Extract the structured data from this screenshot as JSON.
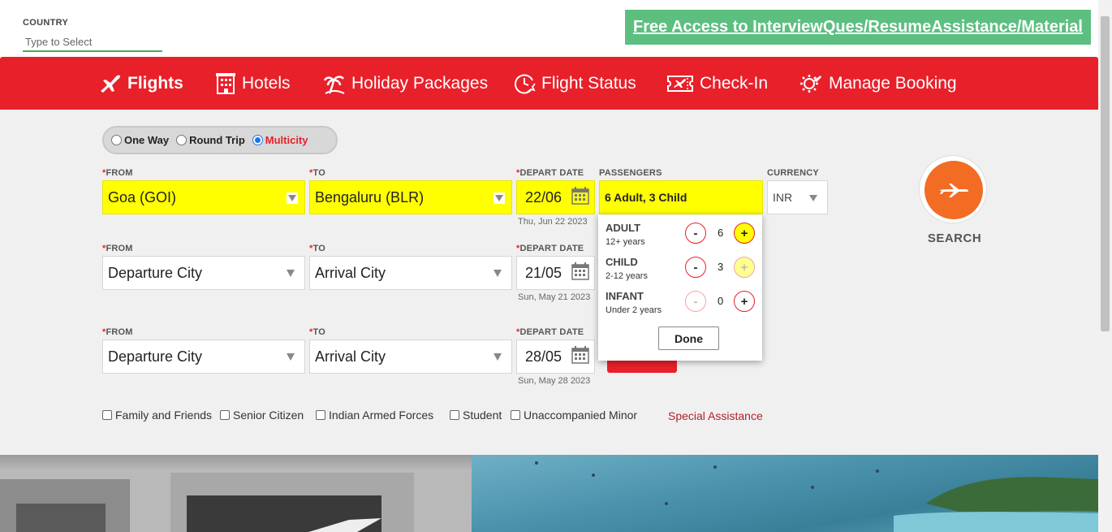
{
  "top": {
    "country_label": "COUNTRY",
    "country_placeholder": "Type to Select",
    "promo_link": "Free Access to InterviewQues/ResumeAssistance/Material"
  },
  "nav": {
    "items": [
      {
        "label": "Flights",
        "icon": "airplane-icon",
        "active": true
      },
      {
        "label": "Hotels",
        "icon": "hotel-building-icon",
        "active": false
      },
      {
        "label": "Holiday Packages",
        "icon": "palm-tree-icon",
        "active": false
      },
      {
        "label": "Flight Status",
        "icon": "clock-plane-icon",
        "active": false
      },
      {
        "label": "Check-In",
        "icon": "ticket-plane-icon",
        "active": false
      },
      {
        "label": "Manage Booking",
        "icon": "gear-plane-icon",
        "active": false
      }
    ]
  },
  "trip_type": {
    "options": [
      "One Way",
      "Round Trip",
      "Multicity"
    ],
    "selected": "Multicity"
  },
  "labels": {
    "from": "FROM",
    "to": "TO",
    "depart_date": "DEPART DATE",
    "passengers": "PASSENGERS",
    "currency": "CURRENCY",
    "required_mark": "*"
  },
  "legs": [
    {
      "from": "Goa (GOI)",
      "to": "Bengaluru (BLR)",
      "date": "22/06",
      "date_full": "Thu, Jun 22 2023",
      "highlighted": true
    },
    {
      "from": "Departure City",
      "to": "Arrival City",
      "date": "21/05",
      "date_full": "Sun, May 21 2023",
      "highlighted": false
    },
    {
      "from": "Departure City",
      "to": "Arrival City",
      "date": "28/05",
      "date_full": "Sun, May 28 2023",
      "highlighted": false
    }
  ],
  "passengers": {
    "summary": "6 Adult, 3 Child",
    "rows": [
      {
        "name": "ADULT",
        "sub": "12+ years",
        "count": "6"
      },
      {
        "name": "CHILD",
        "sub": "2-12 years",
        "count": "3"
      },
      {
        "name": "INFANT",
        "sub": "Under 2 years",
        "count": "0"
      }
    ],
    "minus": "-",
    "plus": "+",
    "done": "Done"
  },
  "currency": {
    "value": "INR"
  },
  "search": {
    "label": "SEARCH"
  },
  "concessions": {
    "items": [
      "Family and Friends",
      "Senior Citizen",
      "Indian Armed Forces",
      "Student",
      "Unaccompanied Minor"
    ],
    "special_assistance": "Special Assistance"
  },
  "colors": {
    "brand_red": "#e8202a",
    "highlight_yellow": "#ffff00",
    "search_orange": "#f26c23",
    "promo_green": "#5cbf80"
  }
}
